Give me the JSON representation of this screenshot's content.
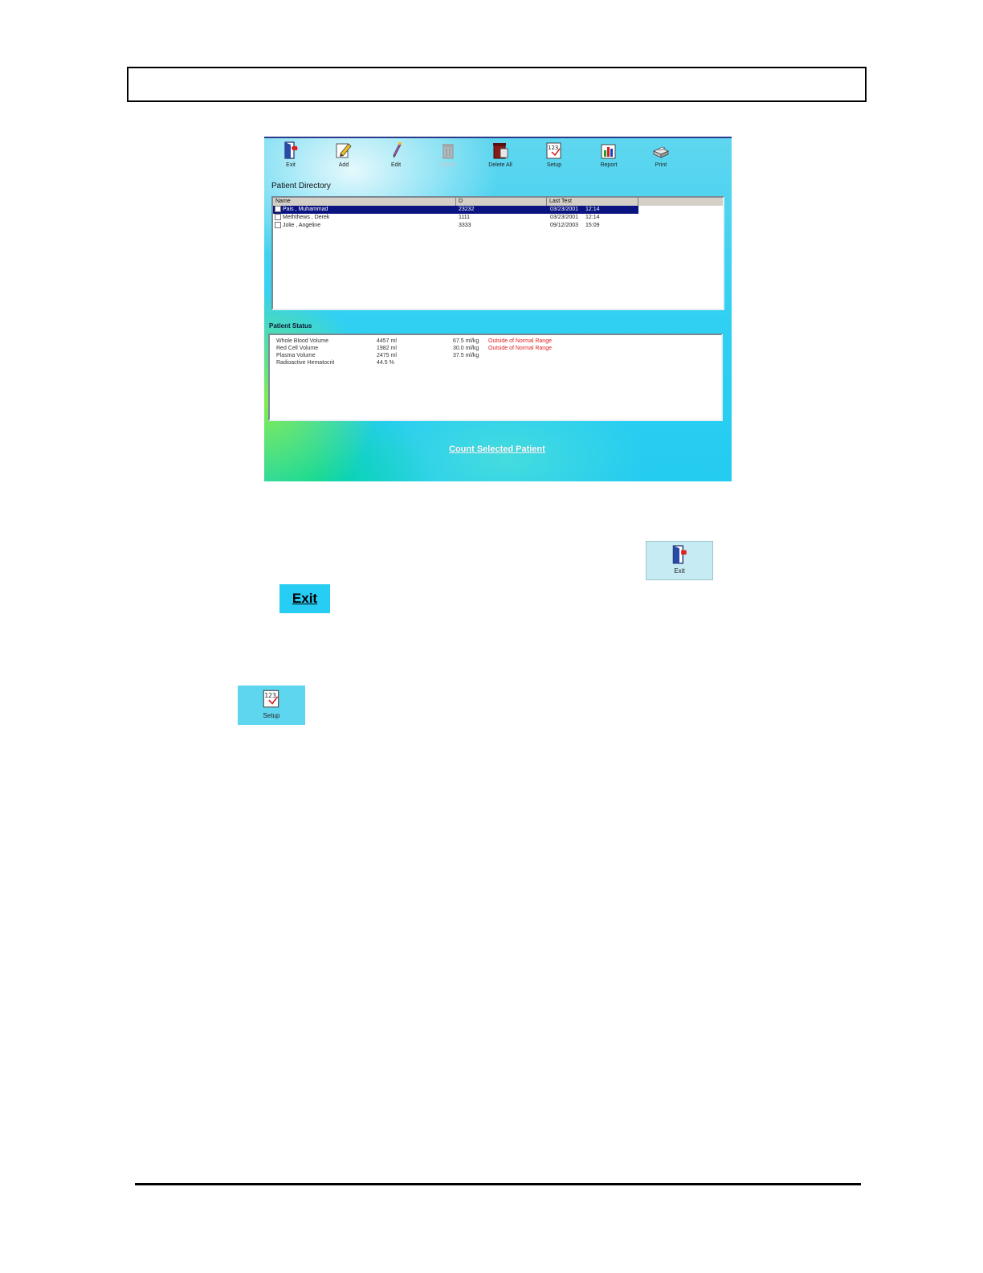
{
  "app": {
    "toolbar": [
      {
        "label": "Exit",
        "icon": "exit-door-icon",
        "enabled": true
      },
      {
        "label": "Add",
        "icon": "add-pencil-icon",
        "enabled": true
      },
      {
        "label": "Edit",
        "icon": "edit-pen-icon",
        "enabled": true
      },
      {
        "label": "Delete",
        "icon": "trash-can-icon",
        "enabled": false
      },
      {
        "label": "Delete All",
        "icon": "delete-all-icon",
        "enabled": true
      },
      {
        "label": "Setup",
        "icon": "setup-calendar-icon",
        "enabled": true
      },
      {
        "label": "Report",
        "icon": "report-chart-icon",
        "enabled": true
      },
      {
        "label": "Print",
        "icon": "printer-icon",
        "enabled": true
      }
    ],
    "patient_directory": {
      "title": "Patient Directory",
      "columns": [
        "Name",
        "D",
        "Last Test"
      ],
      "rows": [
        {
          "name": "Pais , Muhammad",
          "id": "23232",
          "date": "03/23/2001",
          "time": "12:14",
          "selected": true
        },
        {
          "name": "Meththews , Derek",
          "id": "1111",
          "date": "03/23/2001",
          "time": "12:14",
          "selected": false
        },
        {
          "name": "Jolie , Angeline",
          "id": "3333",
          "date": "09/12/2003",
          "time": "15:09",
          "selected": false
        }
      ]
    },
    "patient_status": {
      "title": "Patient Status",
      "rows": [
        {
          "label": "Whole Blood Volume",
          "value": "4457 ml",
          "per_kg": "67.5 ml/kg",
          "note": "Outside of Normal Range"
        },
        {
          "label": "Red Cell Volume",
          "value": "1982 ml",
          "per_kg": "30.0 ml/kg",
          "note": "Outside of Normal Range"
        },
        {
          "label": "Plasma Volume",
          "value": "2475 ml",
          "per_kg": "37.5 ml/kg",
          "note": ""
        },
        {
          "label": "Radioactive Hematocrit",
          "value": "44.5 %",
          "per_kg": "",
          "note": ""
        }
      ]
    },
    "count_button": "Count Selected Patient"
  },
  "figures": {
    "exit_icon_label": "Exit",
    "exit_text_label": "Exit",
    "setup_label": "Setup"
  },
  "colors": {
    "accent": "#27cdf3",
    "selection": "#0a1480",
    "warning": "#e02020"
  }
}
